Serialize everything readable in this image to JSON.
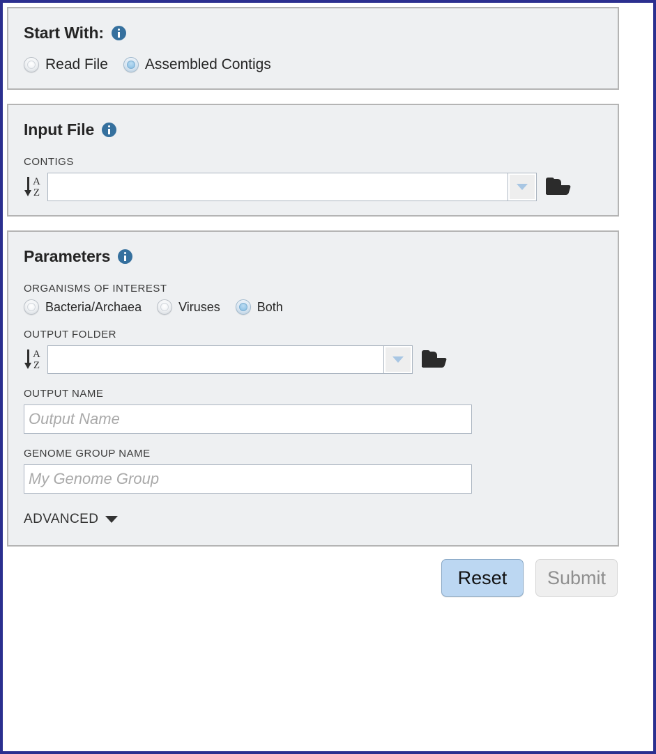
{
  "theme": {
    "frame_border": "#2b2f8f",
    "panel_bg": "#eef0f2",
    "panel_border": "#b4b4b4",
    "info_icon_color": "#35709e",
    "accent_blue": "#bcd7f2",
    "radio_checked": "#9ecbea"
  },
  "start_with": {
    "title": "Start With:",
    "info_icon": "info-icon",
    "options": [
      {
        "label": "Read File",
        "checked": false
      },
      {
        "label": "Assembled Contigs",
        "checked": true
      }
    ]
  },
  "input_file": {
    "title": "Input File",
    "info_icon": "info-icon",
    "contigs": {
      "label": "CONTIGS",
      "value": "",
      "placeholder": "",
      "sort_icon": "sort-az-icon",
      "dropdown_icon": "chevron-down-icon",
      "browse_icon": "folder-open-icon"
    }
  },
  "parameters": {
    "title": "Parameters",
    "info_icon": "info-icon",
    "organisms": {
      "label": "ORGANISMS OF INTEREST",
      "options": [
        {
          "label": "Bacteria/Archaea",
          "checked": false
        },
        {
          "label": "Viruses",
          "checked": false
        },
        {
          "label": "Both",
          "checked": true
        }
      ]
    },
    "output_folder": {
      "label": "OUTPUT FOLDER",
      "value": "",
      "placeholder": "",
      "sort_icon": "sort-az-icon",
      "dropdown_icon": "chevron-down-icon",
      "browse_icon": "folder-open-icon"
    },
    "output_name": {
      "label": "OUTPUT NAME",
      "value": "",
      "placeholder": "Output Name"
    },
    "genome_group_name": {
      "label": "GENOME GROUP NAME",
      "value": "",
      "placeholder": "My Genome Group"
    },
    "advanced": {
      "label": "ADVANCED",
      "icon": "caret-down-icon",
      "expanded": false
    }
  },
  "footer": {
    "reset_label": "Reset",
    "submit_label": "Submit",
    "submit_enabled": false
  }
}
